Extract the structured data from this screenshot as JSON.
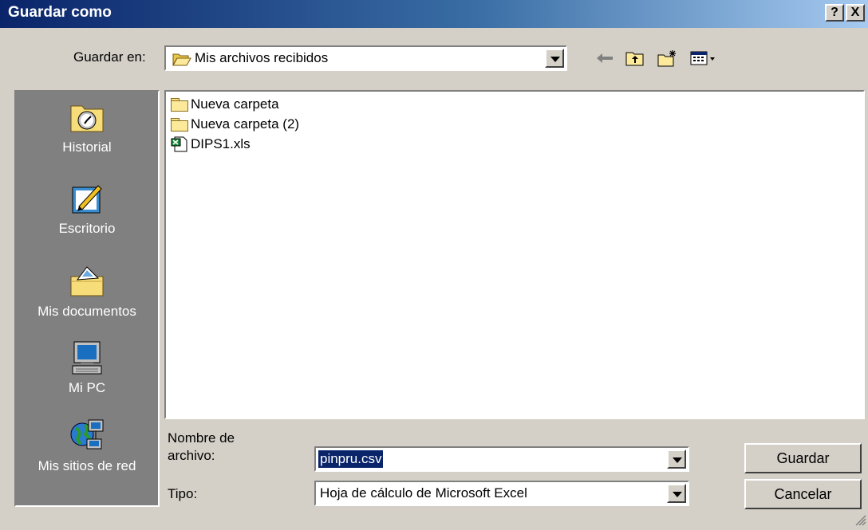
{
  "window": {
    "title": "Guardar como",
    "help_label": "?",
    "close_label": "X"
  },
  "save_in": {
    "label": "Guardar en:",
    "value": "Mis archivos recibidos"
  },
  "toolbar": {
    "back": "back-arrow-icon",
    "up": "up-folder-icon",
    "new_folder": "new-folder-icon",
    "view": "view-menu-icon"
  },
  "places": [
    {
      "label": "Historial",
      "icon": "history-icon"
    },
    {
      "label": "Escritorio",
      "icon": "desktop-icon"
    },
    {
      "label": "Mis documentos",
      "icon": "my-documents-icon"
    },
    {
      "label": "Mi PC",
      "icon": "my-computer-icon"
    },
    {
      "label": "Mis sitios de red",
      "icon": "network-places-icon"
    }
  ],
  "files": [
    {
      "name": "Nueva carpeta",
      "type": "folder"
    },
    {
      "name": "Nueva carpeta (2)",
      "type": "folder"
    },
    {
      "name": "DIPS1.xls",
      "type": "excel"
    }
  ],
  "filename": {
    "label_line1": "Nombre de",
    "label_line2": "archivo:",
    "value": "pinpru.csv"
  },
  "filetype": {
    "label": "Tipo:",
    "value": "Hoja de cálculo de Microsoft Excel"
  },
  "buttons": {
    "save": "Guardar",
    "cancel": "Cancelar"
  }
}
